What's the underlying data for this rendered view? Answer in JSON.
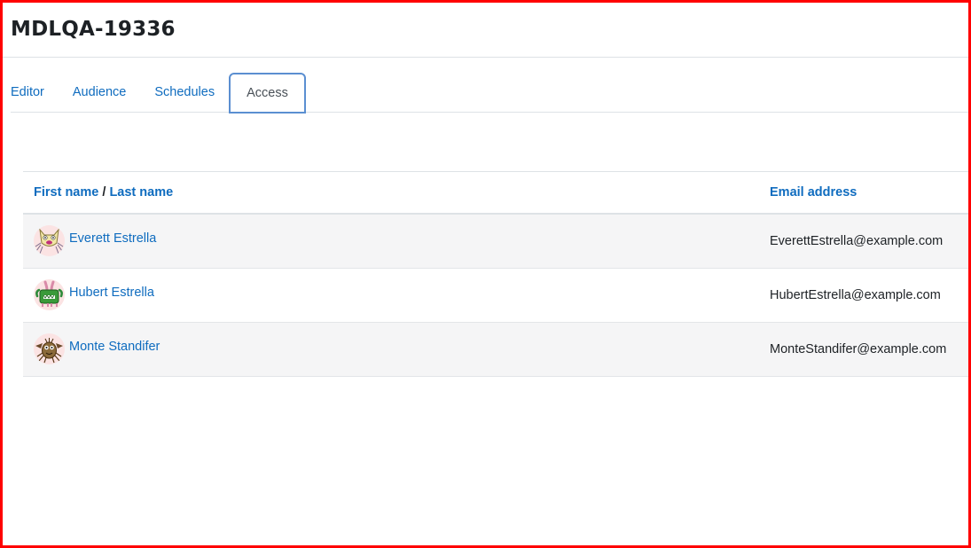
{
  "page": {
    "title": "MDLQA-19336"
  },
  "tabs": [
    {
      "label": "Editor",
      "active": false
    },
    {
      "label": "Audience",
      "active": false
    },
    {
      "label": "Schedules",
      "active": false
    },
    {
      "label": "Access",
      "active": true
    }
  ],
  "table": {
    "header": {
      "first_name": "First name",
      "separator": "/",
      "last_name": "Last name",
      "email": "Email address"
    },
    "rows": [
      {
        "name": "Everett Estrella",
        "email": "EverettEstrella@example.com",
        "avatar": "monster-spider-avatar-icon"
      },
      {
        "name": "Hubert Estrella",
        "email": "HubertEstrella@example.com",
        "avatar": "monster-green-avatar-icon"
      },
      {
        "name": "Monte Standifer",
        "email": "MonteStandifer@example.com",
        "avatar": "monster-bat-avatar-icon"
      }
    ]
  },
  "colors": {
    "link": "#0f6cbf",
    "frame": "#ff0000",
    "active_tab_border": "#5b8fd1"
  }
}
